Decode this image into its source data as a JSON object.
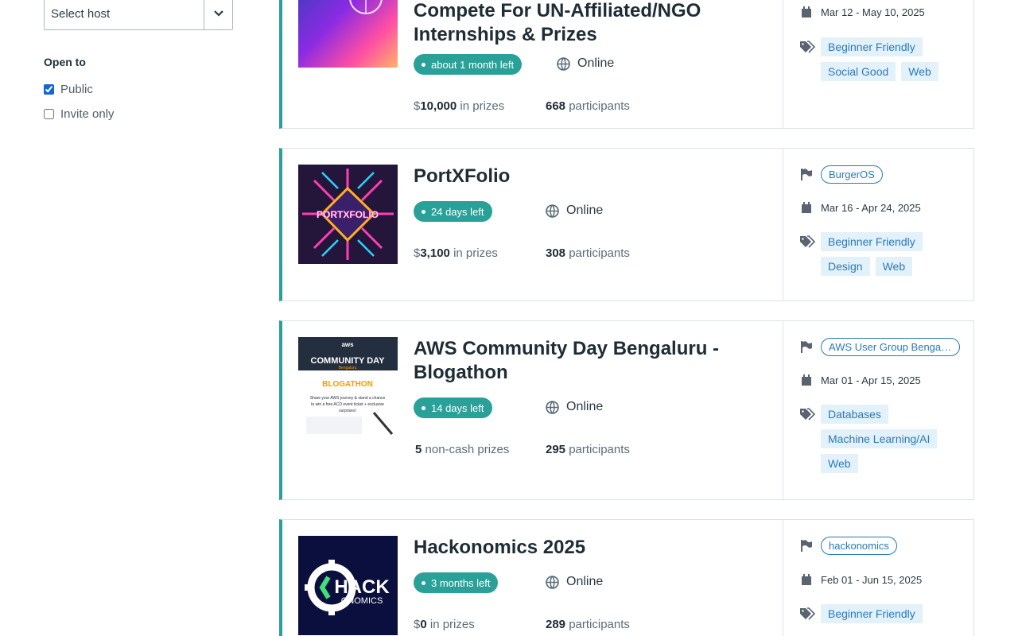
{
  "sidebar": {
    "host_select": "Select host",
    "open_to_title": "Open to",
    "options": [
      {
        "label": "Public",
        "checked": true
      },
      {
        "label": "Invite only",
        "checked": false
      }
    ]
  },
  "hackathons": [
    {
      "title": "Compete For UN-Affiliated/NGO Internships & Prizes",
      "status": "about 1 month left",
      "location": "Online",
      "prize_prefix": "$",
      "prize_amount": "10,000",
      "prize_suffix": "in prizes",
      "participants": "668",
      "participants_label": "participants",
      "host": "",
      "dates": "Mar 12 - May 10, 2025",
      "tags": [
        "Beginner Friendly",
        "Social Good",
        "Web"
      ]
    },
    {
      "title": "PortXFolio",
      "status": "24 days left",
      "location": "Online",
      "prize_prefix": "$",
      "prize_amount": "3,100",
      "prize_suffix": "in prizes",
      "participants": "308",
      "participants_label": "participants",
      "host": "BurgerOS",
      "dates": "Mar 16 - Apr 24, 2025",
      "tags": [
        "Beginner Friendly",
        "Design",
        "Web"
      ],
      "thumb_text": "PORTXFOLIO"
    },
    {
      "title": "AWS Community Day Bengaluru - Blogathon",
      "status": "14 days left",
      "location": "Online",
      "prize_prefix": "",
      "prize_amount": "5",
      "prize_suffix": "non-cash prizes",
      "participants": "295",
      "participants_label": "participants",
      "host": "AWS User Group Bengaluru",
      "dates": "Mar 01 - Apr 15, 2025",
      "tags": [
        "Databases",
        "Machine Learning/AI",
        "Web"
      ],
      "thumb_lines": [
        "aws",
        "COMMUNITY DAY",
        "Bengaluru",
        "BLOGATHON",
        "Share your AWS journey & stand a chance",
        "to win a free ACD event ticket + exclusive",
        "surprises!"
      ]
    },
    {
      "title": "Hackonomics 2025",
      "status": "3 months left",
      "location": "Online",
      "prize_prefix": "$",
      "prize_amount": "0",
      "prize_suffix": "in prizes",
      "participants": "289",
      "participants_label": "participants",
      "host": "hackonomics",
      "dates": "Feb 01 - Jun 15, 2025",
      "tags": [
        "Beginner Friendly"
      ],
      "thumb_lines": [
        "HACK",
        "ONOMICS"
      ]
    }
  ]
}
